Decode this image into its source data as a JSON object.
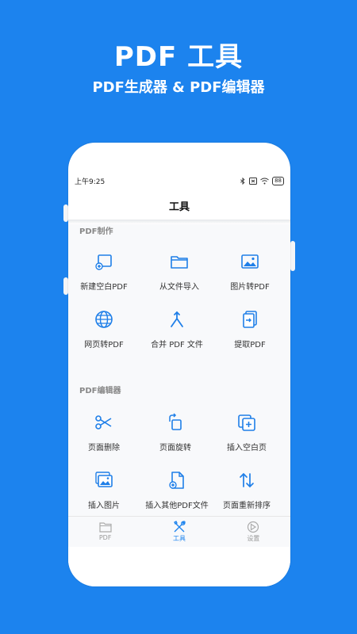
{
  "hero": {
    "title": "PDF 工具",
    "subtitle": "PDF生成器 & PDF编辑器"
  },
  "status_bar": {
    "time": "上午9:25",
    "battery": "88"
  },
  "app": {
    "title": "工具"
  },
  "sections": [
    {
      "title": "PDF制作",
      "tools": [
        {
          "label": "新建空白PDF",
          "icon": "new-blank-icon"
        },
        {
          "label": "从文件导入",
          "icon": "folder-icon"
        },
        {
          "label": "图片转PDF",
          "icon": "image-icon"
        },
        {
          "label": "网页转PDF",
          "icon": "globe-icon"
        },
        {
          "label": "合并 PDF 文件",
          "icon": "merge-icon"
        },
        {
          "label": "提取PDF",
          "icon": "extract-icon"
        }
      ]
    },
    {
      "title": "PDF编辑器",
      "tools": [
        {
          "label": "页面删除",
          "icon": "scissors-icon"
        },
        {
          "label": "页面旋转",
          "icon": "rotate-icon"
        },
        {
          "label": "插入空白页",
          "icon": "add-page-icon"
        },
        {
          "label": "插入图片",
          "icon": "insert-image-icon"
        },
        {
          "label": "插入其他PDF文件",
          "icon": "insert-pdf-icon"
        },
        {
          "label": "页面重新排序",
          "icon": "reorder-icon"
        }
      ]
    }
  ],
  "tabs": [
    {
      "label": "PDF",
      "icon": "folder-icon",
      "active": false
    },
    {
      "label": "工具",
      "icon": "tools-icon",
      "active": true
    },
    {
      "label": "设置",
      "icon": "settings-icon",
      "active": false
    }
  ],
  "colors": {
    "accent": "#1c83ee",
    "icon_blue": "#1f7fe8"
  }
}
